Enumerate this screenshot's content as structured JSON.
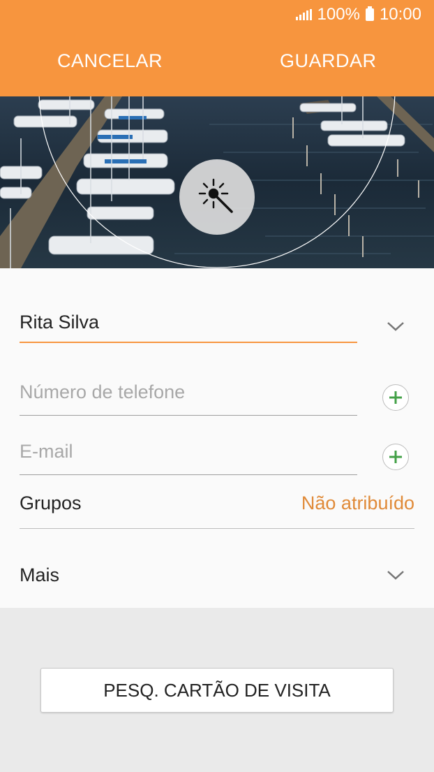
{
  "status_bar": {
    "battery": "100%",
    "time": "10:00",
    "signal_icon": "signal-icon",
    "battery_icon": "battery-icon"
  },
  "toolbar": {
    "cancel_label": "CANCELAR",
    "save_label": "GUARDAR"
  },
  "photo": {
    "icon": "magic-wand-icon"
  },
  "form": {
    "name_value": "Rita Silva",
    "phone_placeholder": "Número de telefone",
    "email_placeholder": "E-mail",
    "groups_label": "Grupos",
    "groups_value": "Não atribuído",
    "more_label": "Mais"
  },
  "footer": {
    "scan_button_label": "PESQ. CARTÃO DE VISITA"
  },
  "colors": {
    "accent": "#f7953e",
    "add_icon": "#43a047",
    "groups_value": "#e08a38"
  }
}
